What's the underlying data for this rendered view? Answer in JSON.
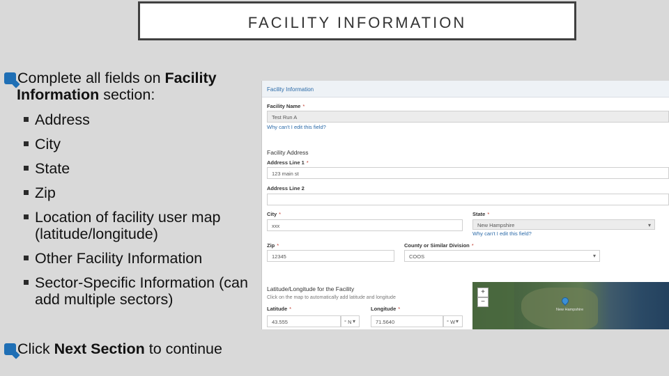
{
  "title": "FACILITY INFORMATION",
  "bullets": {
    "line1_pre": "Complete all fields on ",
    "line1_bold": "Facility",
    "line2_bold": "Information",
    "line2_post": " section:",
    "subitems": {
      "address": "Address",
      "city": "City",
      "state": "State",
      "zip": "Zip",
      "location_1": "Location of facility user map",
      "location_2": "(latitude/longitude)",
      "other": "Other Facility Information",
      "sector_1": "Sector-Specific Information (can",
      "sector_2": "add multiple sectors)"
    },
    "click_pre": "Click ",
    "click_bold": "Next Section",
    "click_post": " to continue"
  },
  "form": {
    "header": "Facility Information",
    "required_mark": "*",
    "facility_name_label": "Facility Name",
    "facility_name_value": "Test Run A",
    "why_cant_edit_1": "Why can't I edit this field?",
    "facility_address_heading": "Facility Address",
    "address1_label": "Address Line 1",
    "address1_value": "123 main st",
    "address2_label": "Address Line 2",
    "address2_value": "",
    "city_label": "City",
    "city_value": "xxx",
    "state_label": "State",
    "state_value": "New Hampshire",
    "why_cant_edit_2": "Why can't I edit this field?",
    "zip_label": "Zip",
    "zip_value": "12345",
    "county_label": "County or Similar Division",
    "county_value": "COOS",
    "latlong_heading": "Latitude/Longitude for the Facility",
    "latlong_hint": "Click on the map to automatically add latitude and longitude",
    "latitude_label": "Latitude",
    "latitude_value": "43.555",
    "latitude_dir": "° N",
    "longitude_label": "Longitude",
    "longitude_value": "71.5640",
    "longitude_dir": "° W",
    "zoom_in": "+",
    "zoom_out": "−",
    "map_labels": {
      "new_hampshire": "New Hampshire"
    }
  }
}
